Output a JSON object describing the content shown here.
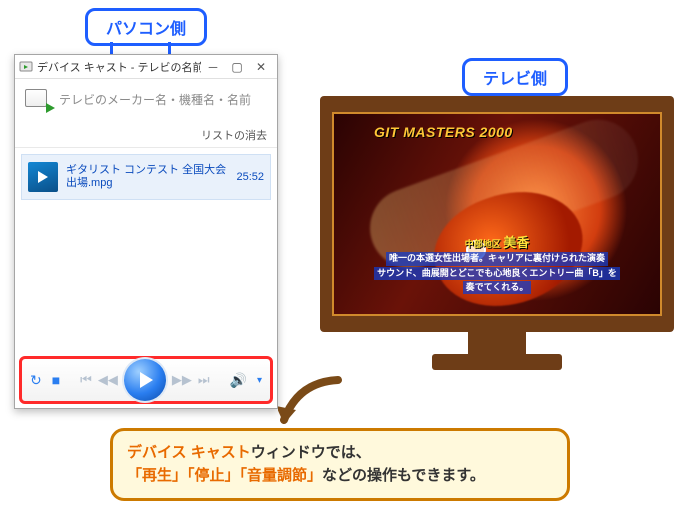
{
  "labels": {
    "pc_side": "パソコン側",
    "tv_side": "テレビ側"
  },
  "window": {
    "title": "デバイス キャスト - テレビの名前",
    "device": "テレビのメーカー名・機種名・名前",
    "list_clear": "リストの消去",
    "item": {
      "name": "ギタリスト コンテスト 全国大会出場.mpg",
      "duration": "25:52"
    },
    "controls": {
      "repeat": "↻",
      "stop": "■",
      "prev2": "⏮",
      "prev1": "◀◀",
      "next1": "▶▶",
      "next2": "⏭",
      "volume": "🔊",
      "caret": "▾"
    }
  },
  "tv": {
    "title": "GIT MASTERS 2000",
    "caption_region_prefix": "中部地区",
    "caption_name": "美香",
    "caption_l1": "唯一の本選女性出場者。キャリアに裏付けられた演奏",
    "caption_l2": "サウンド、曲展開とどこでも心地良くエントリー曲「B」を",
    "caption_l3": "奏でてくれる。"
  },
  "callout": {
    "t1a": "デバイス キャスト",
    "t1b": "ウィンドウでは、",
    "t2a": "「再生」「停止」「音量調節」",
    "t2b": "などの操作もできます。"
  }
}
